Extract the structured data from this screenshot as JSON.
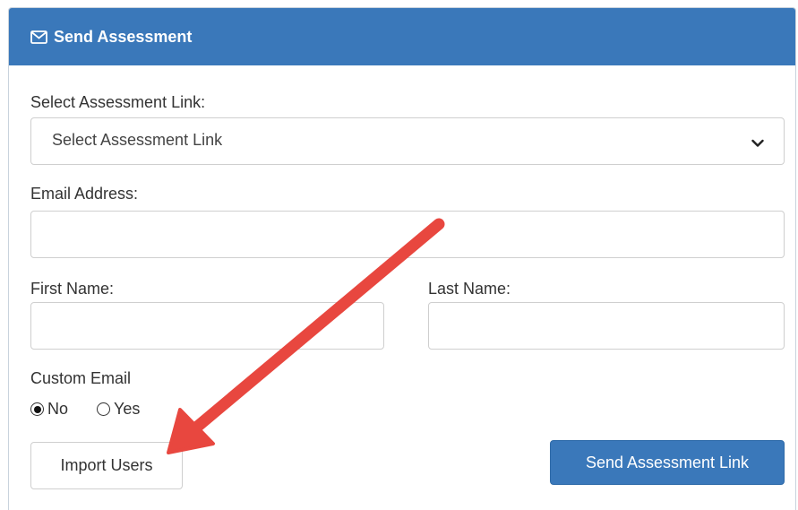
{
  "panel": {
    "title": "Send Assessment",
    "header_color": "#3a78ba",
    "header_icon": "envelope-icon"
  },
  "form": {
    "assessment_link_label": "Select Assessment Link:",
    "assessment_link_selected": "Select Assessment Link",
    "email_label": "Email Address:",
    "email_value": "",
    "first_name_label": "First Name:",
    "first_name_value": "",
    "last_name_label": "Last Name:",
    "last_name_value": "",
    "custom_email_label": "Custom Email",
    "custom_email_options": [
      "No",
      "Yes"
    ],
    "custom_email_selected": "No"
  },
  "buttons": {
    "import_users": "Import Users",
    "send_link": "Send Assessment Link",
    "primary_color": "#3a78ba"
  },
  "annotation": {
    "arrow_color": "#e8473f",
    "arrow_icon": "red-arrow-annotation"
  }
}
